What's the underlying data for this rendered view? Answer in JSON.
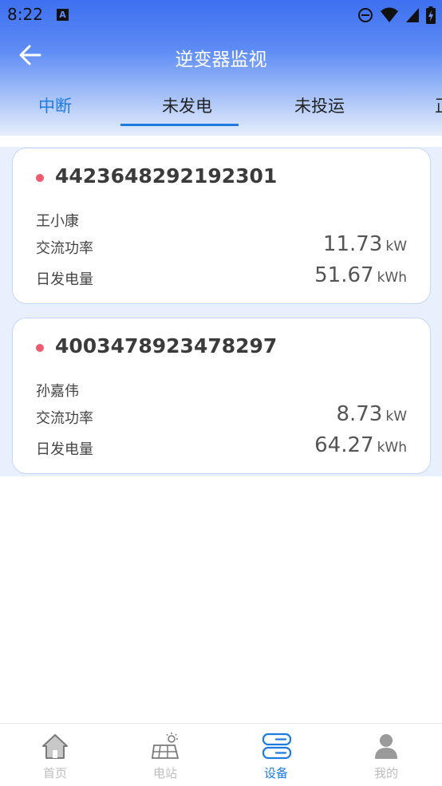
{
  "status_bar": {
    "time": "8:22"
  },
  "header": {
    "title": "逆变器监视"
  },
  "tabs": [
    {
      "label": "中断"
    },
    {
      "label": "未发电"
    },
    {
      "label": "未投运"
    },
    {
      "label": "正"
    }
  ],
  "active_tab": "未发电",
  "inverters": [
    {
      "serial": "4423648292192301",
      "owner": "王小康",
      "ac_power_label": "交流功率",
      "ac_power_value": "11.73",
      "ac_power_unit": "kW",
      "daily_energy_label": "日发电量",
      "daily_energy_value": "51.67",
      "daily_energy_unit": "kWh"
    },
    {
      "serial": "4003478923478297",
      "owner": "孙嘉伟",
      "ac_power_label": "交流功率",
      "ac_power_value": "8.73",
      "ac_power_unit": "kW",
      "daily_energy_label": "日发电量",
      "daily_energy_value": "64.27",
      "daily_energy_unit": "kWh"
    }
  ],
  "bottom_nav": [
    {
      "label": "首页",
      "icon": "home-icon"
    },
    {
      "label": "电站",
      "icon": "solar-panel-icon"
    },
    {
      "label": "设备",
      "icon": "device-icon",
      "active": true
    },
    {
      "label": "我的",
      "icon": "user-icon"
    }
  ],
  "colors": {
    "accent": "#1e7be0",
    "status_dot": "#ef5a6f",
    "header_top": "#3d6ff0"
  }
}
